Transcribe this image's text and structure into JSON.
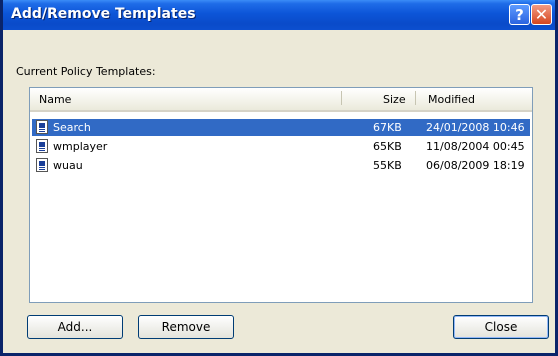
{
  "window": {
    "title": "Add/Remove Templates",
    "help_glyph": "?",
    "close_glyph": "✕"
  },
  "section_label": "Current Policy Templates:",
  "list": {
    "columns": [
      "Name",
      "Size",
      "Modified"
    ],
    "rows": [
      {
        "name": "Search",
        "size": "67KB",
        "modified": "24/01/2008 10:46",
        "selected": true,
        "icon": "policy-template-file-icon"
      },
      {
        "name": "wmplayer",
        "size": "65KB",
        "modified": "11/08/2004 00:45",
        "selected": false,
        "icon": "policy-template-file-icon"
      },
      {
        "name": "wuau",
        "size": "55KB",
        "modified": "06/08/2009 18:19",
        "selected": false,
        "icon": "policy-template-file-icon"
      }
    ]
  },
  "buttons": {
    "add": "Add...",
    "remove": "Remove",
    "close": "Close"
  },
  "colors": {
    "title_bar": "#0a4bc9",
    "selection": "#316ac5",
    "dialog_bg": "#ece9d8"
  }
}
